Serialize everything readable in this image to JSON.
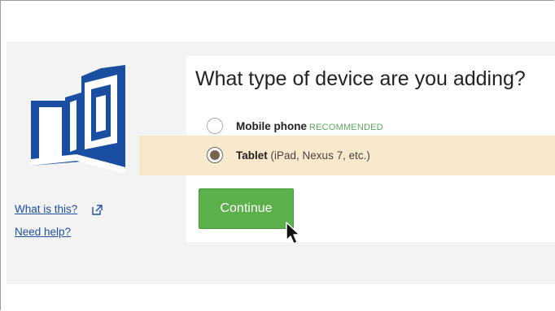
{
  "sidebar": {
    "logo_icon": "book-logo-icon",
    "what_is_this_label": "What is this?",
    "external_link_icon": "external-link-icon",
    "need_help_label": "Need help?"
  },
  "prompt": {
    "title": "What type of device are you adding?",
    "options": [
      {
        "label": "Mobile phone",
        "badge": "RECOMMENDED",
        "selected": false
      },
      {
        "label": "Tablet",
        "note": "(iPad, Nexus 7, etc.)",
        "selected": true
      }
    ],
    "continue_label": "Continue"
  },
  "colors": {
    "brand_blue": "#1a4ea0",
    "link_blue": "#1f4fa3",
    "button_green": "#5cb04b",
    "recommended_green": "#5aa55c",
    "selected_row_highlight": "#f8e9cd"
  }
}
